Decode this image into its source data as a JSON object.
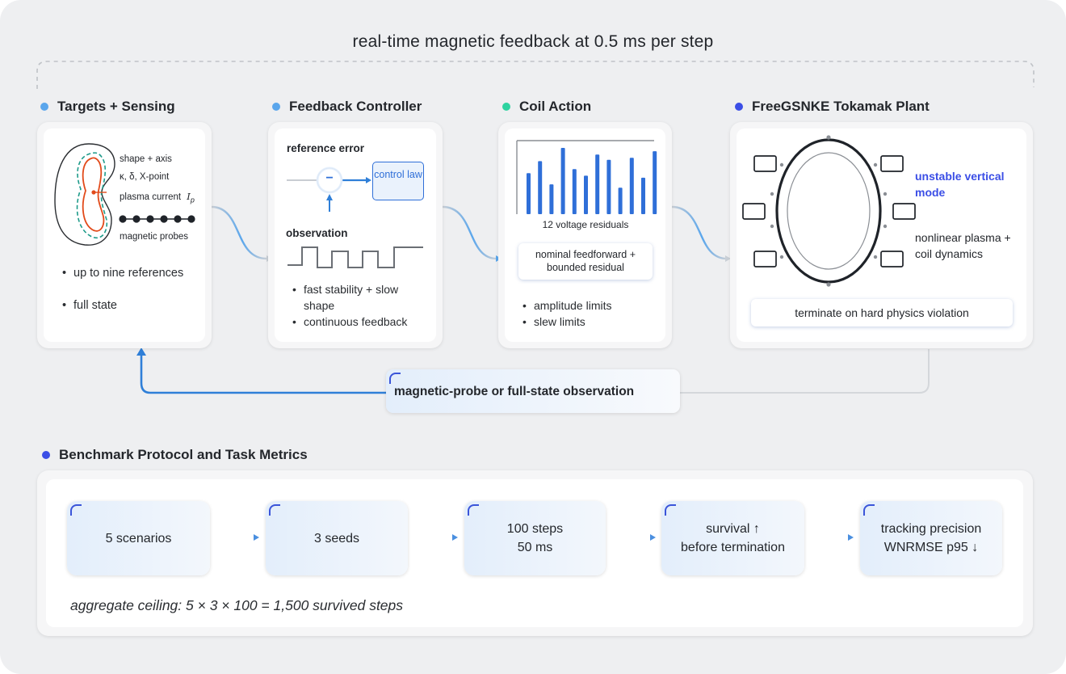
{
  "title": "real-time magnetic feedback at 0.5 ms per step",
  "colors": {
    "sensing_dot": "#5aa6ec",
    "controller_dot": "#5aa6ec",
    "coil_dot": "#2ed3a0",
    "plant_dot": "#3b4ee6",
    "benchmark_dot": "#3b4ee6",
    "accent_blue": "#2f6fd8",
    "plasma_red": "#e24a1a",
    "probe_teal": "#1e9b8a"
  },
  "sections": {
    "sensing": {
      "header": "Targets + Sensing",
      "labels": [
        "shape + axis",
        "κ, δ, X-point",
        "plasma current"
      ],
      "ip_symbol": "I",
      "ip_sub": "p",
      "probes_label": "magnetic probes",
      "bullets": [
        "up to nine references",
        "full state"
      ]
    },
    "controller": {
      "header": "Feedback Controller",
      "error_label": "reference error",
      "minus": "−",
      "law_label": "control law",
      "observation_label": "observation",
      "bullets": [
        "fast stability + slow shape",
        "continuous feedback"
      ]
    },
    "coil": {
      "header": "Coil Action",
      "residuals_label": "12 voltage residuals",
      "feedforward_label": "nominal feedforward + bounded residual",
      "bullets": [
        "amplitude limits",
        "slew limits"
      ]
    },
    "plant": {
      "header": "FreeGSNKE Tokamak Plant",
      "unstable_label": "unstable vertical mode",
      "nonlinear_label": "nonlinear plasma + coil dynamics",
      "terminate_label": "terminate on hard physics violation"
    }
  },
  "feedback_label": "magnetic-probe or full-state observation",
  "benchmark": {
    "header": "Benchmark Protocol and Task Metrics",
    "steps": [
      {
        "line1": "5 scenarios",
        "line2": ""
      },
      {
        "line1": "3 seeds",
        "line2": ""
      },
      {
        "line1": "100 steps",
        "line2": "50 ms"
      },
      {
        "line1": "survival ↑",
        "line2": "before termination"
      },
      {
        "line1": "tracking precision",
        "line2": "WNRMSE p95 ↓"
      }
    ],
    "ceiling": "aggregate ceiling: 5 × 3 × 100 = 1,500 survived steps"
  },
  "chart_data": {
    "type": "bar",
    "title": "",
    "xlabel": "12 voltage residuals",
    "ylabel": "",
    "values": [
      0.62,
      0.8,
      0.45,
      1.0,
      0.68,
      0.58,
      0.9,
      0.82,
      0.4,
      0.85,
      0.55,
      0.95
    ]
  }
}
